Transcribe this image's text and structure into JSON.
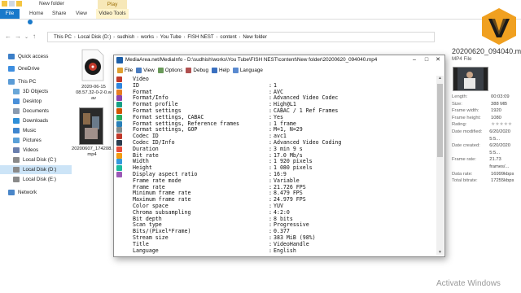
{
  "explorer": {
    "window_title": "New folder",
    "context_tab": "Play",
    "ribbon_tabs": [
      "File",
      "Home",
      "Share",
      "View",
      "Video Tools"
    ],
    "path": [
      "This PC",
      "Local Disk (D:)",
      "sudhish",
      "works",
      "You Tube",
      "FISH NEST",
      "content",
      "New folder"
    ],
    "nav_items": [
      {
        "label": "Quick access",
        "color": "#3c7fc8"
      },
      {
        "label": "OneDrive",
        "color": "#3d8ee0"
      },
      {
        "label": "This PC",
        "color": "#5a9bd6"
      },
      {
        "label": "3D Objects",
        "color": "#6aa7d8"
      },
      {
        "label": "Desktop",
        "color": "#4a90d9"
      },
      {
        "label": "Documents",
        "color": "#8a9bb0"
      },
      {
        "label": "Downloads",
        "color": "#2f8fd8"
      },
      {
        "label": "Music",
        "color": "#3f86cf"
      },
      {
        "label": "Pictures",
        "color": "#5aa0d8"
      },
      {
        "label": "Videos",
        "color": "#6a7fae"
      },
      {
        "label": "Local Disk (C:)",
        "color": "#8a8a8a"
      },
      {
        "label": "Local Disk (D:)",
        "color": "#8a8a8a"
      },
      {
        "label": "Local Disk (E:)",
        "color": "#8a8a8a"
      },
      {
        "label": "Network",
        "color": "#4a86c8"
      }
    ],
    "files": [
      {
        "name_line1": "2020-06-15",
        "name_line2": "08.57.32-0-2-0.w",
        "name_line3": "av"
      },
      {
        "name_line1": "20200607_174208.",
        "name_line2": "mp4",
        "name_line3": ""
      }
    ],
    "details": {
      "title": "20200620_094040.mp4",
      "type": "MP4 File",
      "props": [
        {
          "k": "Length:",
          "v": "00:03:09"
        },
        {
          "k": "Size:",
          "v": "388 MB"
        },
        {
          "k": "Frame width:",
          "v": "1920"
        },
        {
          "k": "Frame height:",
          "v": "1080"
        },
        {
          "k": "Rating:",
          "v": "★★★★★"
        },
        {
          "k": "Date modified:",
          "v": "6/20/2020 5:5..."
        },
        {
          "k": "Date created:",
          "v": "6/20/2020 5:5..."
        },
        {
          "k": "Frame rate:",
          "v": "21.73 frames/..."
        },
        {
          "k": "Data rate:",
          "v": "16999kbps"
        },
        {
          "k": "Total bitrate:",
          "v": "17255kbps"
        }
      ]
    }
  },
  "mediainfo": {
    "title": "MediaArea.net/MediaInfo - D:\\sudhish\\works\\You Tube\\FISH NEST\\content\\New folder\\20200620_094040.mp4",
    "menu": [
      {
        "label": "File",
        "color": "#e0a030"
      },
      {
        "label": "View",
        "color": "#4a7cc0"
      },
      {
        "label": "Options",
        "color": "#6a9a5a"
      },
      {
        "label": "Debug",
        "color": "#b05050"
      },
      {
        "label": "Help",
        "color": "#3a70c0"
      },
      {
        "label": "Language",
        "color": "#5a8ad0"
      }
    ],
    "lines": [
      {
        "k": "Video",
        "v": "",
        "icon": "#c0392b"
      },
      {
        "k": "ID",
        "v": "1",
        "icon": "#2e86de"
      },
      {
        "k": "Format",
        "v": "AVC",
        "icon": "#e67e22"
      },
      {
        "k": "Format/Info",
        "v": "Advanced Video Codec",
        "icon": "#8e44ad"
      },
      {
        "k": "Format profile",
        "v": "High@L1",
        "icon": "#16a085"
      },
      {
        "k": "Format settings",
        "v": "CABAC / 1 Ref Frames",
        "icon": "#d35400"
      },
      {
        "k": "Format settings, CABAC",
        "v": "Yes",
        "icon": "#27ae60"
      },
      {
        "k": "Format settings, Reference frames",
        "v": "1 frame",
        "icon": "#2980b9"
      },
      {
        "k": "Format settings, GOP",
        "v": "M=1, N=29",
        "icon": "#7f8c8d"
      },
      {
        "k": "Codec ID",
        "v": "avc1",
        "icon": "#c0392b"
      },
      {
        "k": "Codec ID/Info",
        "v": "Advanced Video Coding",
        "icon": "#2c3e50"
      },
      {
        "k": "Duration",
        "v": "3 min 9 s",
        "icon": "#e74c3c"
      },
      {
        "k": "Bit rate",
        "v": "17.0 Mb/s",
        "icon": "#f39c12"
      },
      {
        "k": "Width",
        "v": "1 920 pixels",
        "icon": "#3498db"
      },
      {
        "k": "Height",
        "v": "1 080 pixels",
        "icon": "#1abc9c"
      },
      {
        "k": "Display aspect ratio",
        "v": "16:9",
        "icon": "#9b59b6"
      },
      {
        "k": "Frame rate mode",
        "v": "Variable",
        "icon": ""
      },
      {
        "k": "Frame rate",
        "v": "21.726 FPS",
        "icon": ""
      },
      {
        "k": "Minimum frame rate",
        "v": "8.479 FPS",
        "icon": ""
      },
      {
        "k": "Maximum frame rate",
        "v": "24.979 FPS",
        "icon": ""
      },
      {
        "k": "Color space",
        "v": "YUV",
        "icon": ""
      },
      {
        "k": "Chroma subsampling",
        "v": "4:2:0",
        "icon": ""
      },
      {
        "k": "Bit depth",
        "v": "8 bits",
        "icon": ""
      },
      {
        "k": "Scan type",
        "v": "Progressive",
        "icon": ""
      },
      {
        "k": "Bits/(Pixel*Frame)",
        "v": "0.377",
        "icon": ""
      },
      {
        "k": "Stream size",
        "v": "383 MiB (98%)",
        "icon": ""
      },
      {
        "k": "Title",
        "v": "VideoHandle",
        "icon": ""
      },
      {
        "k": "Language",
        "v": "English",
        "icon": ""
      }
    ]
  },
  "watermark": "Activate Windows"
}
